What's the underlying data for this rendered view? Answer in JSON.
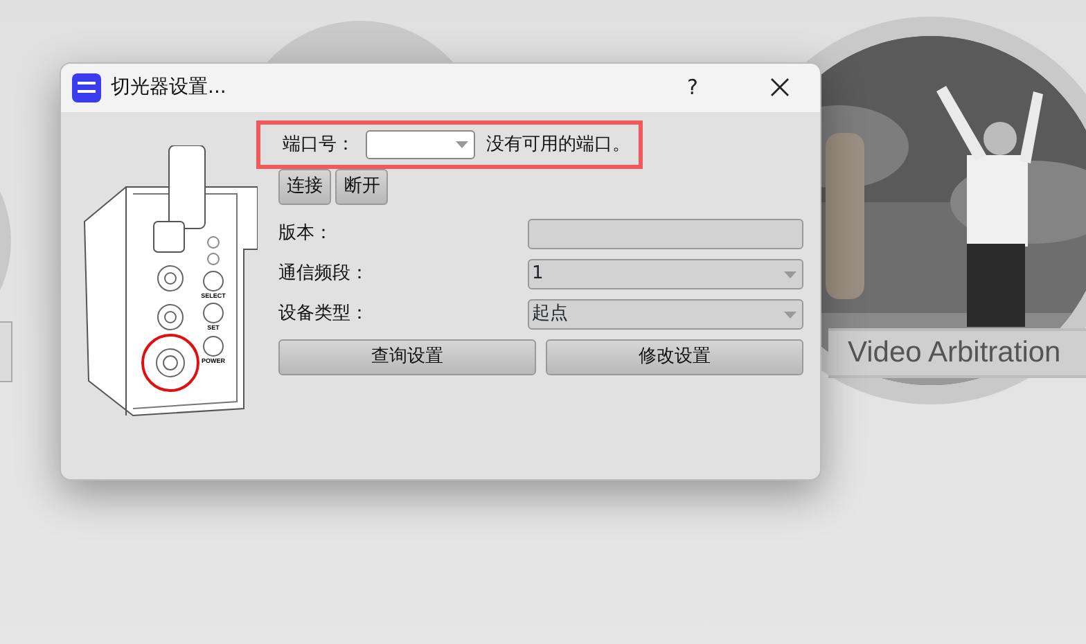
{
  "background": {
    "caption": "Video Arbitration"
  },
  "window": {
    "title": "切光器设置...",
    "help": "?"
  },
  "port": {
    "label": "端口号：",
    "highlighted": true,
    "message": "没有可用的端口。"
  },
  "connection_buttons": [
    "连接",
    "断开"
  ],
  "device": {
    "labels": [
      "SELECT",
      "SET",
      "POWER"
    ],
    "highlighted_port": true
  },
  "fields": [
    {
      "kind": "text",
      "label": "版本："
    },
    {
      "kind": "select",
      "label": "通信频段：",
      "value": "1"
    },
    {
      "kind": "select",
      "label": "设备类型：",
      "value": "起点"
    }
  ],
  "action_buttons": [
    "查询设置",
    "修改设置"
  ]
}
